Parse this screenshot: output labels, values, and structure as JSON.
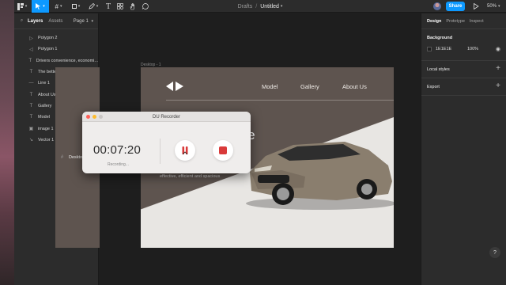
{
  "toolbar": {
    "file_breadcrumb": "Drafts",
    "separator": "/",
    "file_name": "Untitled",
    "share_label": "Share",
    "zoom_level": "50%",
    "accent_color": "#0d99ff"
  },
  "left_panel": {
    "tabs": [
      "Layers",
      "Assets"
    ],
    "page_label": "Page 1",
    "frame_name": "Desktop - 1",
    "layers": [
      {
        "icon": "polygon-icon",
        "name": "Polygon 2"
      },
      {
        "icon": "polygon-icon",
        "name": "Polygon 1"
      },
      {
        "icon": "text-icon",
        "name": "Drivers convenience, economi..."
      },
      {
        "icon": "text-icon",
        "name": "The better choice for shoppers"
      },
      {
        "icon": "line-icon",
        "name": "Line 1"
      },
      {
        "icon": "text-icon",
        "name": "About Us"
      },
      {
        "icon": "text-icon",
        "name": "Gallery"
      },
      {
        "icon": "text-icon",
        "name": "Model"
      },
      {
        "icon": "image-icon",
        "name": "image 1"
      },
      {
        "icon": "vector-icon",
        "name": "Vector 1"
      }
    ]
  },
  "canvas": {
    "frame_label": "Desktop - 1",
    "nav": [
      "Model",
      "Gallery",
      "About Us"
    ],
    "headline_line1": "hoice",
    "headline_line2": "s",
    "subtext": "effective, efficient and spacious"
  },
  "right_panel": {
    "tabs": [
      "Design",
      "Prototype",
      "Inspect"
    ],
    "background_title": "Background",
    "background_hex": "1E1E1E",
    "background_opacity": "100%",
    "local_styles_title": "Local styles",
    "export_title": "Export",
    "help_label": "?"
  },
  "recorder": {
    "title": "DU Recorder",
    "time": "00:07:20",
    "status": "Recording...",
    "record_color": "#d93a3a"
  }
}
